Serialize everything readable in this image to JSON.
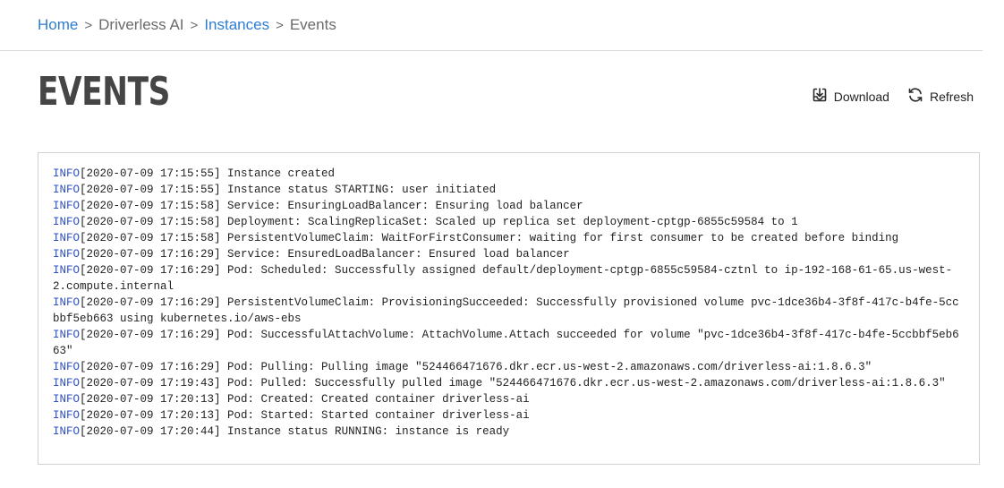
{
  "breadcrumb": {
    "home": "Home",
    "product": "Driverless AI",
    "instances": "Instances",
    "current": "Events",
    "separator": ">"
  },
  "page": {
    "title": "EVENTS"
  },
  "actions": {
    "download_label": "Download",
    "refresh_label": "Refresh"
  },
  "colors": {
    "link": "#2f7dd1",
    "log_level": "#2d4fc4",
    "title": "#454545"
  },
  "log": [
    {
      "level": "INFO",
      "text": "[2020-07-09 17:15:55] Instance created"
    },
    {
      "level": "INFO",
      "text": "[2020-07-09 17:15:55] Instance status STARTING: user initiated"
    },
    {
      "level": "INFO",
      "text": "[2020-07-09 17:15:58] Service: EnsuringLoadBalancer: Ensuring load balancer"
    },
    {
      "level": "INFO",
      "text": "[2020-07-09 17:15:58] Deployment: ScalingReplicaSet: Scaled up replica set deployment-cptgp-6855c59584 to 1"
    },
    {
      "level": "INFO",
      "text": "[2020-07-09 17:15:58] PersistentVolumeClaim: WaitForFirstConsumer: waiting for first consumer to be created before binding"
    },
    {
      "level": "INFO",
      "text": "[2020-07-09 17:16:29] Service: EnsuredLoadBalancer: Ensured load balancer"
    },
    {
      "level": "INFO",
      "text": "[2020-07-09 17:16:29] Pod: Scheduled: Successfully assigned default/deployment-cptgp-6855c59584-cztnl to ip-192-168-61-65.us-west-2.compute.internal"
    },
    {
      "level": "INFO",
      "text": "[2020-07-09 17:16:29] PersistentVolumeClaim: ProvisioningSucceeded: Successfully provisioned volume pvc-1dce36b4-3f8f-417c-b4fe-5ccbbf5eb663 using kubernetes.io/aws-ebs"
    },
    {
      "level": "INFO",
      "text": "[2020-07-09 17:16:29] Pod: SuccessfulAttachVolume: AttachVolume.Attach succeeded for volume \"pvc-1dce36b4-3f8f-417c-b4fe-5ccbbf5eb663\""
    },
    {
      "level": "INFO",
      "text": "[2020-07-09 17:16:29] Pod: Pulling: Pulling image \"524466471676.dkr.ecr.us-west-2.amazonaws.com/driverless-ai:1.8.6.3\""
    },
    {
      "level": "INFO",
      "text": "[2020-07-09 17:19:43] Pod: Pulled: Successfully pulled image \"524466471676.dkr.ecr.us-west-2.amazonaws.com/driverless-ai:1.8.6.3\""
    },
    {
      "level": "INFO",
      "text": "[2020-07-09 17:20:13] Pod: Created: Created container driverless-ai"
    },
    {
      "level": "INFO",
      "text": "[2020-07-09 17:20:13] Pod: Started: Started container driverless-ai"
    },
    {
      "level": "INFO",
      "text": "[2020-07-09 17:20:44] Instance status RUNNING: instance is ready"
    }
  ]
}
